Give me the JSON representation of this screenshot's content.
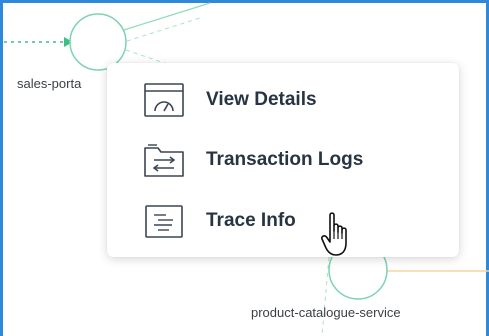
{
  "graph": {
    "nodes": [
      {
        "label": "sales-porta"
      },
      {
        "label": "product-catalogue-service"
      }
    ]
  },
  "context_menu": {
    "items": [
      {
        "label": "View Details",
        "icon": "gauge-window-icon"
      },
      {
        "label": "Transaction Logs",
        "icon": "folder-arrows-icon"
      },
      {
        "label": "Trace Info",
        "icon": "document-lines-icon"
      }
    ]
  },
  "cursor": {
    "icon": "hand-pointer-cursor-icon"
  },
  "colors": {
    "frame_border": "#2e8ad8",
    "node_stroke": "#7ed3b0",
    "edge_green": "#3cbf86",
    "edge_orange": "#f7d4a4",
    "menu_text": "#283443"
  }
}
